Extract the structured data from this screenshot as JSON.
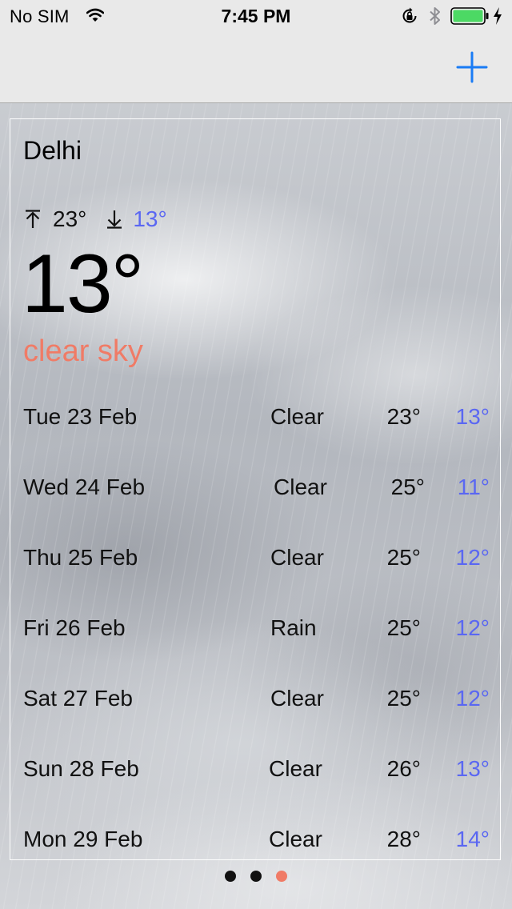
{
  "status_bar": {
    "carrier": "No SIM",
    "time": "7:45 PM",
    "icons": [
      "wifi-icon",
      "rotation-lock-icon",
      "bluetooth-icon",
      "battery-icon",
      "charging-icon"
    ],
    "battery_color": "#4cd964"
  },
  "nav_bar": {
    "add_icon": "plus-icon",
    "accent_color": "#1a7cf5"
  },
  "weather": {
    "city": "Delhi",
    "high": "23°",
    "low": "13°",
    "current_temp": "13°",
    "condition": "clear sky",
    "condition_color": "#f07b66",
    "low_color": "#5a67f2",
    "forecast": [
      {
        "date": "Tue 23 Feb",
        "condition": "Clear",
        "high": "23°",
        "low": "13°"
      },
      {
        "date": "Wed 24 Feb",
        "condition": "Clear",
        "high": "25°",
        "low": "11°"
      },
      {
        "date": "Thu 25 Feb",
        "condition": "Clear",
        "high": "25°",
        "low": "12°"
      },
      {
        "date": "Fri 26 Feb",
        "condition": "Rain",
        "high": "25°",
        "low": "12°"
      },
      {
        "date": "Sat 27 Feb",
        "condition": "Clear",
        "high": "25°",
        "low": "12°"
      },
      {
        "date": "Sun 28 Feb",
        "condition": "Clear",
        "high": "26°",
        "low": "13°"
      },
      {
        "date": "Mon 29 Feb",
        "condition": "Clear",
        "high": "28°",
        "low": "14°"
      }
    ]
  },
  "page_control": {
    "pages": 3,
    "current_page": 3,
    "active_color": "#f07b66",
    "inactive_color": "#111111"
  }
}
